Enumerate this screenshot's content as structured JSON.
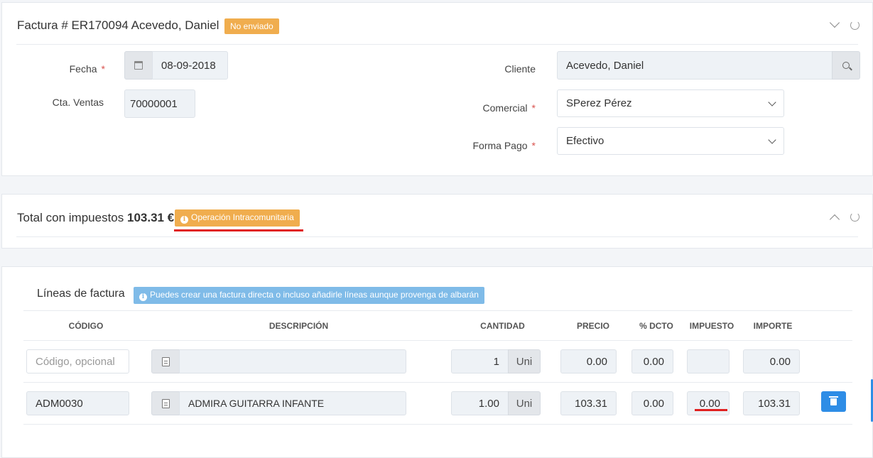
{
  "invoice": {
    "title": "Factura # ER170094 Acevedo, Daniel",
    "status_badge": "No enviado",
    "fecha_label": "Fecha",
    "fecha_value": "08-09-2018",
    "cta_label": "Cta. Ventas",
    "cta_value": "70000001",
    "cliente_label": "Cliente",
    "cliente_value": "Acevedo, Daniel",
    "comercial_label": "Comercial",
    "comercial_value": "SPerez Pérez",
    "forma_pago_label": "Forma Pago",
    "forma_pago_value": "Efectivo",
    "required_mark": "*"
  },
  "totals": {
    "label": "Total con impuestos",
    "amount": "103.31 €",
    "badge": "Operación Intracomunitaria"
  },
  "lines": {
    "title": "Líneas de factura",
    "info_badge": "Puedes crear una factura directa o incluso añadirle líneas aunque provenga de albarán",
    "headers": [
      "CÓDIGO",
      "DESCRIPCIÓN",
      "CANTIDAD",
      "PRECIO",
      "% DCTO",
      "IMPUESTO",
      "IMPORTE"
    ],
    "new_row": {
      "codigo_placeholder": "Código, opcional",
      "cantidad": "1",
      "unit": "Uni",
      "precio": "0.00",
      "dcto": "0.00",
      "impuesto": "",
      "importe": "0.00"
    },
    "rows": [
      {
        "codigo": "ADM0030",
        "descripcion": "ADMIRA GUITARRA INFANTE",
        "cantidad": "1.00",
        "unit": "Uni",
        "precio": "103.31",
        "dcto": "0.00",
        "impuesto": "0.00",
        "importe": "103.31"
      }
    ]
  },
  "icons": {
    "collapse": "chevron-down-icon",
    "expand": "chevron-up-icon",
    "refresh": "refresh-icon",
    "calendar": "calendar-icon",
    "search": "search-icon",
    "document": "document-icon",
    "trash": "trash-icon",
    "info": "info-icon"
  },
  "colors": {
    "warning": "#f0ad4e",
    "info": "#7fbbe8",
    "primary": "#2e8de6",
    "highlight": "#e02020"
  }
}
